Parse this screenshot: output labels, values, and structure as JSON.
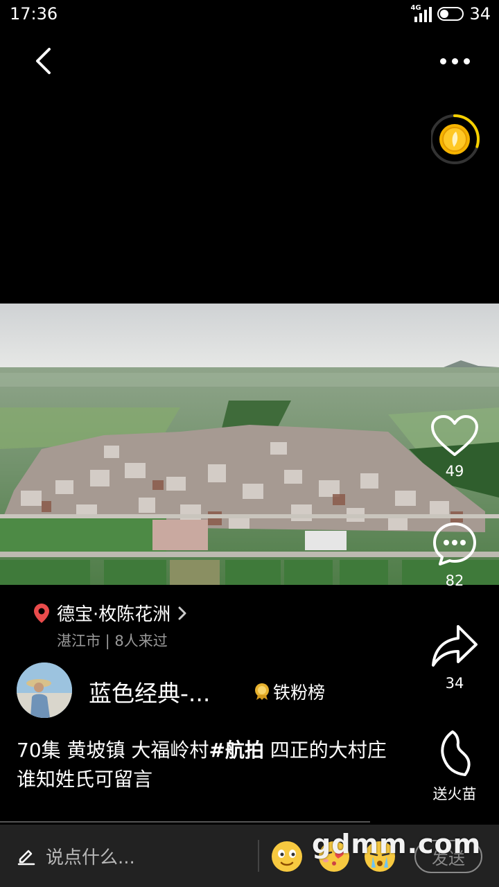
{
  "status_bar": {
    "time": "17:36",
    "network": "4G",
    "battery_level": "34"
  },
  "icons": {
    "back": "chevron-left-icon",
    "more": "more-dots-icon",
    "coin": "gold-coin-icon",
    "like": "heart-icon",
    "comment": "comment-bubble-icon",
    "share": "share-arrow-icon",
    "fire": "flame-icon",
    "location": "location-pin-icon",
    "edit": "pencil-icon"
  },
  "colors": {
    "location_pin": "#e94b4b",
    "coin": "#f6b400",
    "ring": "#f6d000"
  },
  "video": {
    "coin_timer_progress": 0.3
  },
  "actions": {
    "like_count": "49",
    "comment_count": "82",
    "share_count": "34",
    "fire_label": "送火苗"
  },
  "location": {
    "name": "德宝·枚陈花洲",
    "subtitle": "湛江市 | 8人来过"
  },
  "author": {
    "name": "蓝色经典-...",
    "fan_rank_label": "铁粉榜"
  },
  "caption": {
    "before_tag": "70集 黄坡镇  大福岭村",
    "tag": "#航拍",
    "after_tag": "  四正的大村庄 谁知姓氏可留言"
  },
  "input_bar": {
    "placeholder": "说点什么...",
    "send_label": "发送",
    "emojis": [
      "smile-emoji-icon",
      "kiss-emoji-icon",
      "cry-emoji-icon"
    ]
  },
  "watermark": "gdmm.com"
}
